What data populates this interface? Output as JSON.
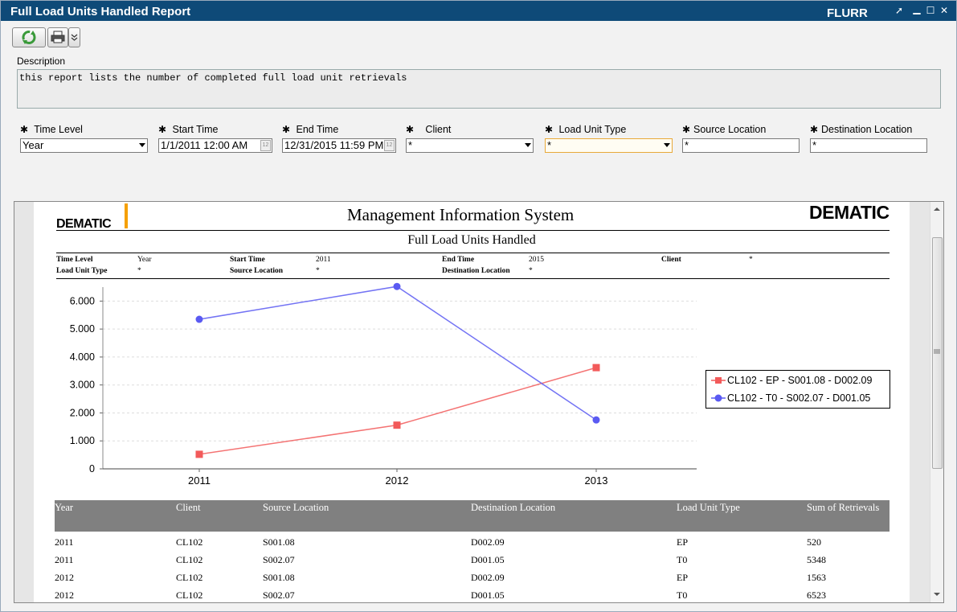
{
  "window": {
    "title": "Full Load Units Handled Report",
    "code": "FLURR",
    "controls": [
      "pin-icon",
      "minimize-icon",
      "maximize-icon",
      "close-icon"
    ]
  },
  "toolbar": {
    "refresh_icon": "refresh-icon",
    "print_icon": "print-icon",
    "more_icon": "chevron-down-icon"
  },
  "description": {
    "label": "Description",
    "text": "this report lists the number of completed full load unit retrievals"
  },
  "params": {
    "time_level": {
      "label": "Time Level",
      "value": "Year"
    },
    "start_time": {
      "label": "Start Time",
      "value": "1/1/2011 12:00 AM"
    },
    "end_time": {
      "label": "End Time",
      "value": "12/31/2015 11:59 PM"
    },
    "client": {
      "label": "Client",
      "value": "*"
    },
    "load_unit_type": {
      "label": "Load Unit Type",
      "value": "*"
    },
    "source_location": {
      "label": "Source Location",
      "value": "*"
    },
    "destination_location": {
      "label": "Destination Location",
      "value": "*"
    },
    "required_marker": "✱"
  },
  "report": {
    "brand_left": "DEMATIC",
    "brand_right": "DEMATIC",
    "system_title": "Management Information System",
    "report_title": "Full Load Units Handled",
    "meta": {
      "time_level_label": "Time Level",
      "time_level_value": "Year",
      "start_time_label": "Start Time",
      "start_time_value": "2011",
      "end_time_label": "End Time",
      "end_time_value": "2015",
      "client_label": "Client",
      "client_value": "*",
      "load_unit_type_label": "Load Unit Type",
      "load_unit_type_value": "*",
      "source_location_label": "Source Location",
      "source_location_value": "*",
      "destination_location_label": "Destination Location",
      "destination_location_value": "*"
    },
    "table": {
      "headers": [
        "Year",
        "Client",
        "Source Location",
        "Destination Location",
        "Load Unit Type",
        "Sum of Retrievals"
      ],
      "rows": [
        [
          "2011",
          "CL102",
          "S001.08",
          "D002.09",
          "EP",
          "520"
        ],
        [
          "2011",
          "CL102",
          "S002.07",
          "D001.05",
          "T0",
          "5348"
        ],
        [
          "2012",
          "CL102",
          "S001.08",
          "D002.09",
          "EP",
          "1563"
        ],
        [
          "2012",
          "CL102",
          "S002.07",
          "D001.05",
          "T0",
          "6523"
        ]
      ]
    }
  },
  "chart_data": {
    "type": "line",
    "x": [
      "2011",
      "2012",
      "2013"
    ],
    "ylim": [
      0,
      6500
    ],
    "yticks": [
      0,
      1000,
      2000,
      3000,
      4000,
      5000,
      6000
    ],
    "ytick_labels": [
      "0",
      "1.000",
      "2.000",
      "3.000",
      "4.000",
      "5.000",
      "6.000"
    ],
    "grid": true,
    "legend_position": "right",
    "series": [
      {
        "name": "CL102 - EP - S001.08 - D002.09",
        "values": [
          520,
          1563,
          3620
        ],
        "color": "#f25a5a",
        "marker": "square"
      },
      {
        "name": "CL102 - T0 - S002.07 - D001.05",
        "values": [
          5348,
          6523,
          1750
        ],
        "color": "#5a5af2",
        "marker": "circle"
      }
    ]
  }
}
